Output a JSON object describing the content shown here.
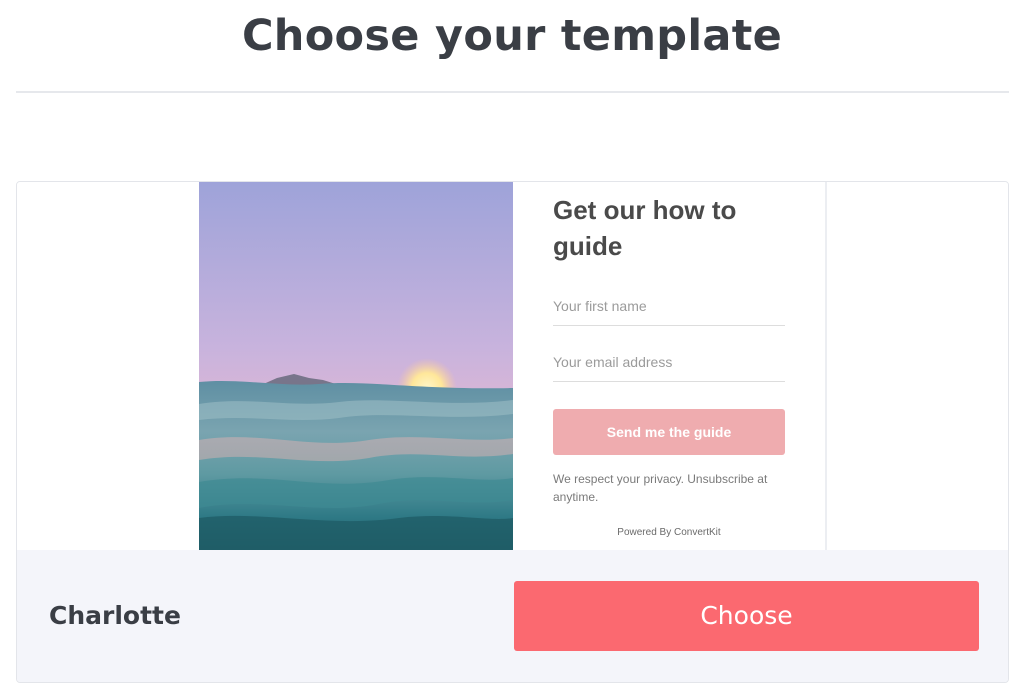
{
  "page": {
    "title": "Choose your template"
  },
  "template": {
    "name": "Charlotte",
    "choose_label": "Choose",
    "accent_color": "#fb6970",
    "preview": {
      "heading": "Get our how to guide",
      "first_name_placeholder": "Your first name",
      "email_placeholder": "Your email address",
      "submit_label": "Send me the guide",
      "privacy_text": "We respect your privacy. Unsubscribe at anytime.",
      "powered_by": "Powered By ConvertKit",
      "image_description_icon": "ocean-sunset-image"
    }
  }
}
